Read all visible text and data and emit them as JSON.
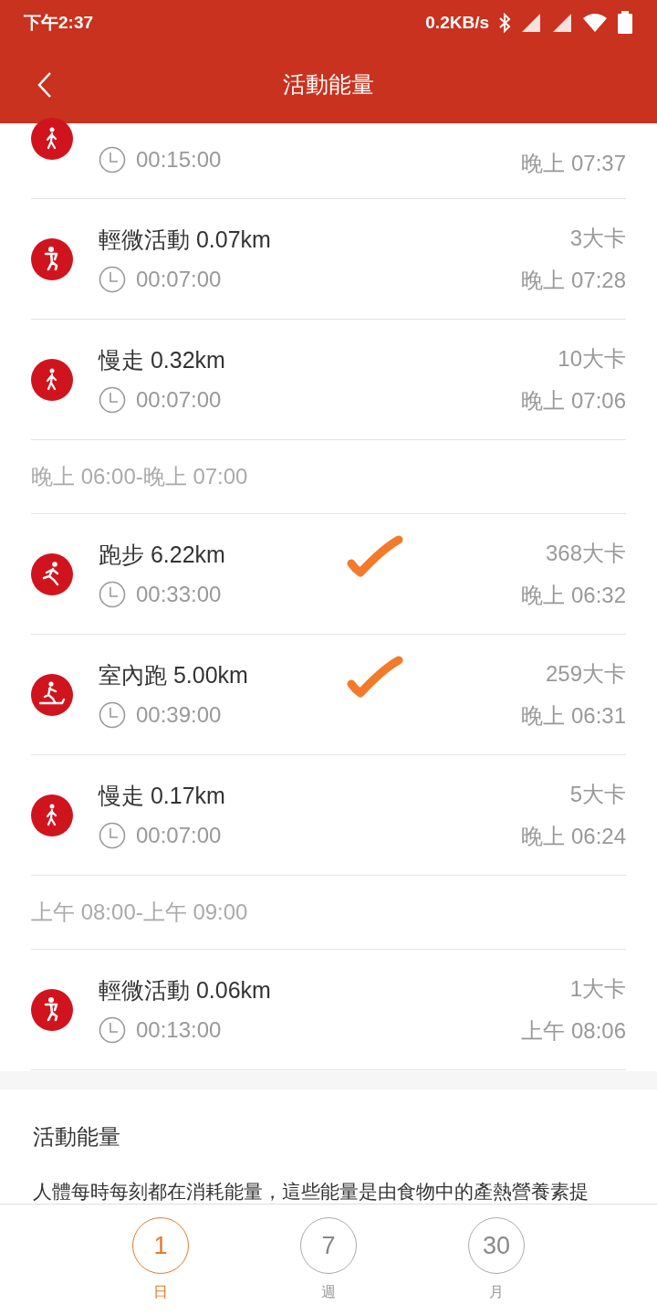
{
  "status_bar": {
    "time": "下午2:37",
    "speed": "0.2KB/s"
  },
  "header": {
    "title": "活動能量"
  },
  "groups": [
    {
      "rows": [
        {
          "kind": "walk",
          "duration": "00:15:00",
          "time": "晚上 07:37",
          "checked": false
        },
        {
          "kind": "light",
          "title": "輕微活動 0.07km",
          "calories": "3大卡",
          "duration": "00:07:00",
          "time": "晚上 07:28",
          "checked": false
        },
        {
          "kind": "walk",
          "title": "慢走 0.32km",
          "calories": "10大卡",
          "duration": "00:07:00",
          "time": "晚上 07:06",
          "checked": false
        }
      ]
    },
    {
      "heading": "晚上 06:00-晚上 07:00",
      "rows": [
        {
          "kind": "run",
          "title": "跑步 6.22km",
          "calories": "368大卡",
          "duration": "00:33:00",
          "time": "晚上 06:32",
          "checked": true
        },
        {
          "kind": "treadmill",
          "title": "室內跑 5.00km",
          "calories": "259大卡",
          "duration": "00:39:00",
          "time": "晚上 06:31",
          "checked": true
        },
        {
          "kind": "walk",
          "title": "慢走 0.17km",
          "calories": "5大卡",
          "duration": "00:07:00",
          "time": "晚上 06:24",
          "checked": false
        }
      ]
    },
    {
      "heading": "上午 08:00-上午 09:00",
      "rows": [
        {
          "kind": "light",
          "title": "輕微活動 0.06km",
          "calories": "1大卡",
          "duration": "00:13:00",
          "time": "上午 08:06",
          "checked": false
        }
      ]
    }
  ],
  "info": {
    "title": "活動能量",
    "text": "人體每時每刻都在消耗能量，這些能量是由食物中的產熱營養素提"
  },
  "tabs": [
    {
      "number": "1",
      "label": "日",
      "selected": true
    },
    {
      "number": "7",
      "label": "週",
      "selected": false
    },
    {
      "number": "30",
      "label": "月",
      "selected": false
    }
  ]
}
